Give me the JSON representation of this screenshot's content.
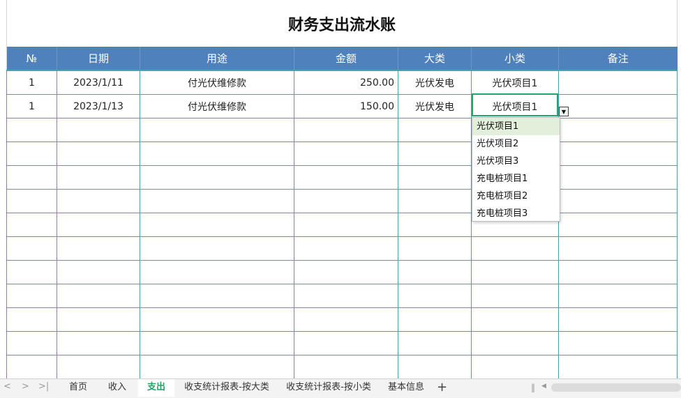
{
  "sheet_title": "财务支出流水账",
  "columns": [
    "№",
    "日期",
    "用途",
    "金额",
    "大类",
    "小类",
    "备注"
  ],
  "rows": [
    [
      "1",
      "2023/1/11",
      "付光伏维修款",
      "250.00",
      "光伏发电",
      "光伏项目1",
      ""
    ],
    [
      "1",
      "2023/1/13",
      "付光伏维修款",
      "150.00",
      "光伏发电",
      "光伏项目1",
      ""
    ],
    [
      "",
      "",
      "",
      "",
      "",
      "",
      ""
    ],
    [
      "",
      "",
      "",
      "",
      "",
      "",
      ""
    ],
    [
      "",
      "",
      "",
      "",
      "",
      "",
      ""
    ],
    [
      "",
      "",
      "",
      "",
      "",
      "",
      ""
    ],
    [
      "",
      "",
      "",
      "",
      "",
      "",
      ""
    ],
    [
      "",
      "",
      "",
      "",
      "",
      "",
      ""
    ],
    [
      "",
      "",
      "",
      "",
      "",
      "",
      ""
    ],
    [
      "",
      "",
      "",
      "",
      "",
      "",
      ""
    ],
    [
      "",
      "",
      "",
      "",
      "",
      "",
      ""
    ],
    [
      "",
      "",
      "",
      "",
      "",
      "",
      ""
    ],
    [
      "",
      "",
      "",
      "",
      "",
      "",
      ""
    ]
  ],
  "dropdown": {
    "options": [
      "光伏项目1",
      "光伏项目2",
      "光伏项目3",
      "充电桩项目1",
      "充电桩项目2",
      "充电桩项目3"
    ],
    "selected": "光伏项目1"
  },
  "tabs": [
    {
      "label": "首页",
      "active": false
    },
    {
      "label": "收入",
      "active": false
    },
    {
      "label": "支出",
      "active": true
    },
    {
      "label": "收支统计报表-按大类",
      "active": false
    },
    {
      "label": "收支统计报表-按小类",
      "active": false
    },
    {
      "label": "基本信息",
      "active": false
    }
  ],
  "nav": {
    "first": "<",
    "prev": ">",
    "last": ">|",
    "add": "+"
  },
  "colors": {
    "header_bg": "#4f81bd",
    "grid_line": "#4aa3a8",
    "active_tab": "#21a366",
    "selected_option": "#e2efda"
  },
  "icons": [
    "nav-first-icon",
    "nav-prev-icon",
    "nav-last-icon",
    "add-sheet-icon",
    "dropdown-arrow-icon",
    "scroll-left-icon"
  ]
}
